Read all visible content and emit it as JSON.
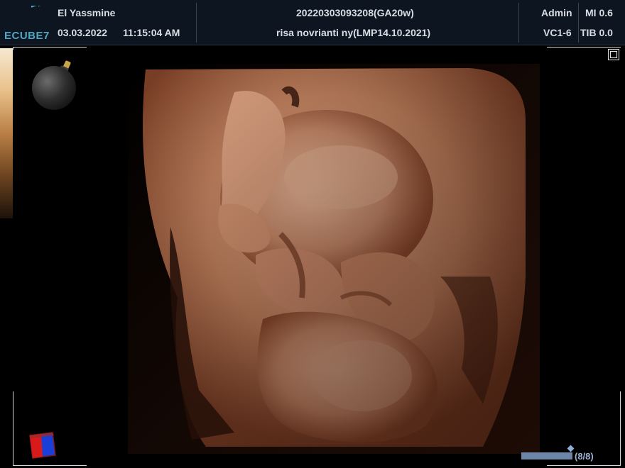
{
  "header": {
    "logo_text": "ECUBE7",
    "institution": "El Yassmine",
    "date": "03.03.2022",
    "time": "11:15:04 AM",
    "study_id": "20220303093208(GA20w)",
    "patient": "risa novrianti ny(LMP14.10.2021)",
    "user": "Admin",
    "probe": "VC1-6",
    "mi": "MI 0.6",
    "tib": "TIB 0.0"
  },
  "cine": {
    "counter": "(8/8)",
    "progress": 1.0
  },
  "colors": {
    "header_bg": "#0d1520",
    "accent": "#4ea6c2",
    "skin_tone": "#c98a66"
  },
  "icons": [
    "bomb-icon",
    "fullscreen-icon",
    "orientation-cube-icon",
    "grayscale-bar"
  ]
}
